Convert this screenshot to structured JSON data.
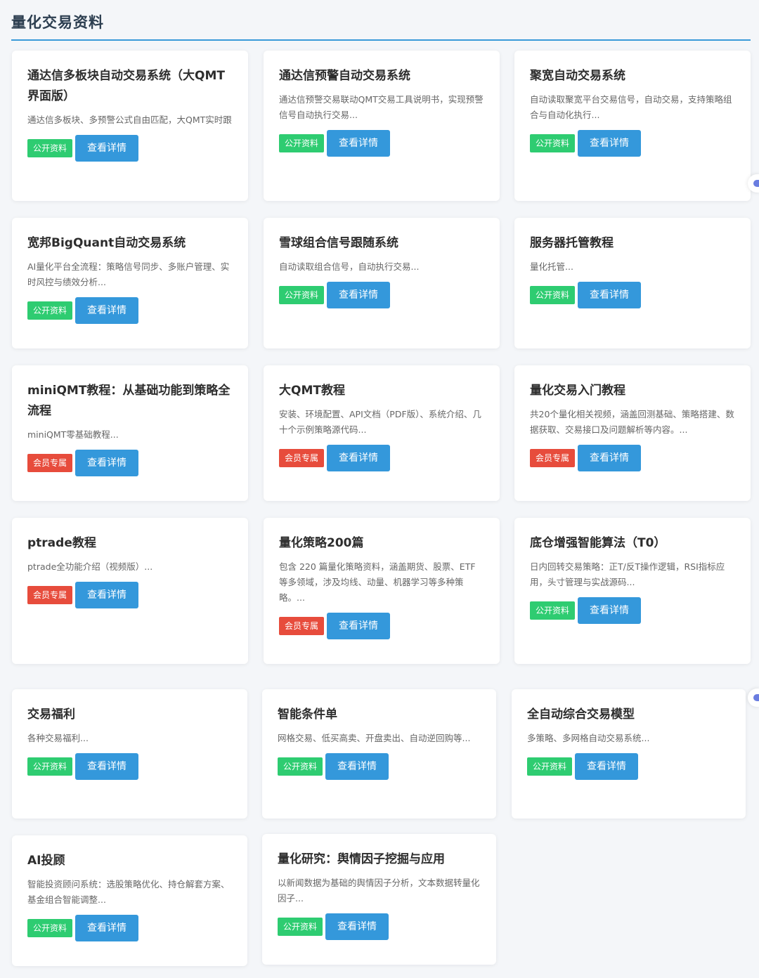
{
  "page": {
    "title": "量化交易资料",
    "detail_label": "查看详情",
    "badge_public": "公开资料",
    "badge_member": "会员专属"
  },
  "colors": {
    "accent": "#3a9ad9",
    "public": "#2ecc71",
    "member": "#e74c3c",
    "button": "#3498db"
  },
  "cards": [
    {
      "title": "通达信多板块自动交易系统（大QMT界面版）",
      "desc": "通达信多板块、多预警公式自由匹配，大QMT实时跟",
      "badge": "公开资料",
      "badge_type": "public"
    },
    {
      "title": "通达信预警自动交易系统",
      "desc": "通达信预警交易联动QMT交易工具说明书，实现预警信号自动执行交易...",
      "badge": "公开资料",
      "badge_type": "public"
    },
    {
      "title": "聚宽自动交易系统",
      "desc": "自动读取聚宽平台交易信号，自动交易，支持策略组合与自动化执行...",
      "badge": "公开资料",
      "badge_type": "public"
    },
    {
      "title": "宽邦BigQuant自动交易系统",
      "desc": "AI量化平台全流程：策略信号同步、多账户管理、实时风控与绩效分析...",
      "badge": "公开资料",
      "badge_type": "public"
    },
    {
      "title": "雪球组合信号跟随系统",
      "desc": "自动读取组合信号，自动执行交易...",
      "badge": "公开资料",
      "badge_type": "public"
    },
    {
      "title": "服务器托管教程",
      "desc": "量化托管...",
      "badge": "公开资料",
      "badge_type": "public"
    },
    {
      "title": "miniQMT教程：从基础功能到策略全流程",
      "desc": "miniQMT零基础教程...",
      "badge": "会员专属",
      "badge_type": "member"
    },
    {
      "title": "大QMT教程",
      "desc": "安装、环境配置、API文档（PDF版）、系统介绍、几十个示例策略源代码...",
      "badge": "会员专属",
      "badge_type": "member"
    },
    {
      "title": "量化交易入门教程",
      "desc": "共20个量化相关视频，涵盖回测基础、策略搭建、数据获取、交易接口及问题解析等内容。...",
      "badge": "会员专属",
      "badge_type": "member"
    },
    {
      "title": "ptrade教程",
      "desc": "ptrade全功能介绍（视频版）...",
      "badge": "会员专属",
      "badge_type": "member"
    },
    {
      "title": "量化策略200篇",
      "desc": "包含 220 篇量化策略资料，涵盖期货、股票、ETF等多领域，涉及均线、动量、机器学习等多种策略。...",
      "badge": "会员专属",
      "badge_type": "member"
    },
    {
      "title": "底仓增强智能算法（T0）",
      "desc": "日内回转交易策略：正T/反T操作逻辑，RSI指标应用，头寸管理与实战源码...",
      "badge": "公开资料",
      "badge_type": "public"
    },
    {
      "title": "交易福利",
      "desc": "各种交易福利...",
      "badge": "公开资料",
      "badge_type": "public"
    },
    {
      "title": "智能条件单",
      "desc": "网格交易、低买高卖、开盘卖出、自动逆回购等...",
      "badge": "公开资料",
      "badge_type": "public"
    },
    {
      "title": "全自动综合交易模型",
      "desc": "多策略、多网格自动交易系统...",
      "badge": "公开资料",
      "badge_type": "public"
    },
    {
      "title": "AI投顾",
      "desc": "智能投资顾问系统：选股策略优化、持仓解套方案、基金组合智能调整...",
      "badge": "公开资料",
      "badge_type": "public"
    },
    {
      "title": "量化研究：舆情因子挖掘与应用",
      "desc": "以新闻数据为基础的舆情因子分析，文本数据转量化因子...",
      "badge": "公开资料",
      "badge_type": "public"
    }
  ]
}
